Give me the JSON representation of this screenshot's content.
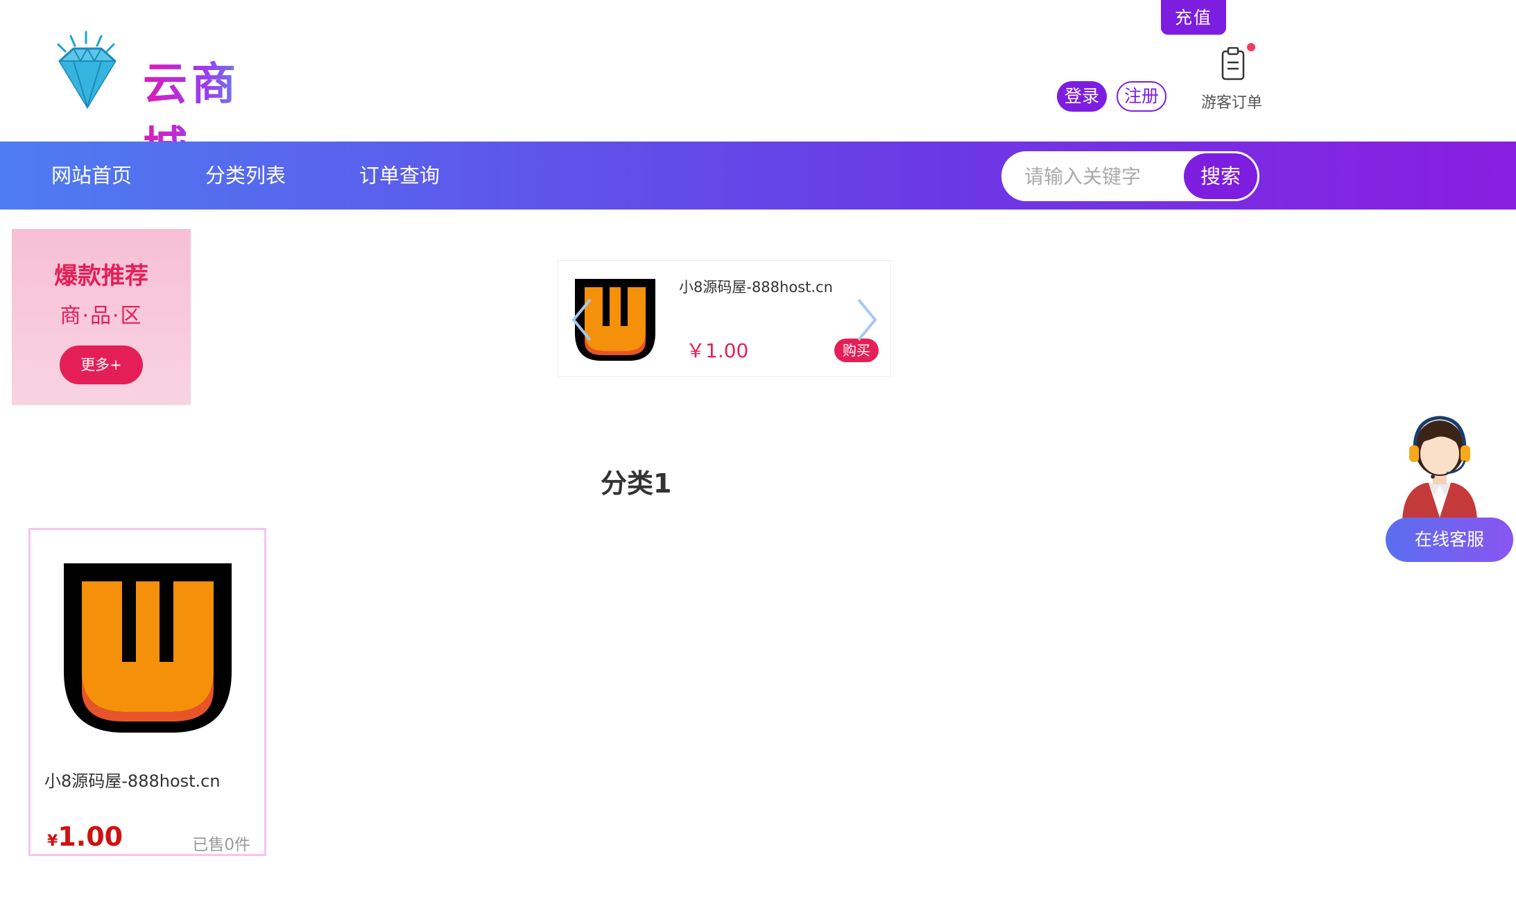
{
  "header": {
    "logo_text": "云商城",
    "recharge_label": "充值",
    "login_label": "登录",
    "register_label": "注册",
    "guest_order_label": "游客订单"
  },
  "nav": {
    "items": [
      {
        "label": "网站首页"
      },
      {
        "label": "分类列表"
      },
      {
        "label": "订单查询"
      }
    ],
    "search_placeholder": "请输入关键字",
    "search_button": "搜索"
  },
  "hot": {
    "title": "爆款推荐",
    "subtitle": "商·品·区",
    "more_label": "更多+"
  },
  "carousel": {
    "item": {
      "name": "小8源码屋-888host.cn",
      "price": "￥1.00",
      "buy_label": "购买"
    }
  },
  "category": {
    "title": "分类1",
    "products": [
      {
        "name": "小8源码屋-888host.cn",
        "currency": "¥",
        "price": "1.00",
        "sold": "已售0件"
      }
    ]
  },
  "service": {
    "label": "在线客服"
  },
  "colors": {
    "accent": "#7d1de0",
    "pink": "#e41f58",
    "nav_gradient_start": "#4e7cf1",
    "nav_gradient_end": "#8a1ee0",
    "price_red": "#d21010"
  }
}
